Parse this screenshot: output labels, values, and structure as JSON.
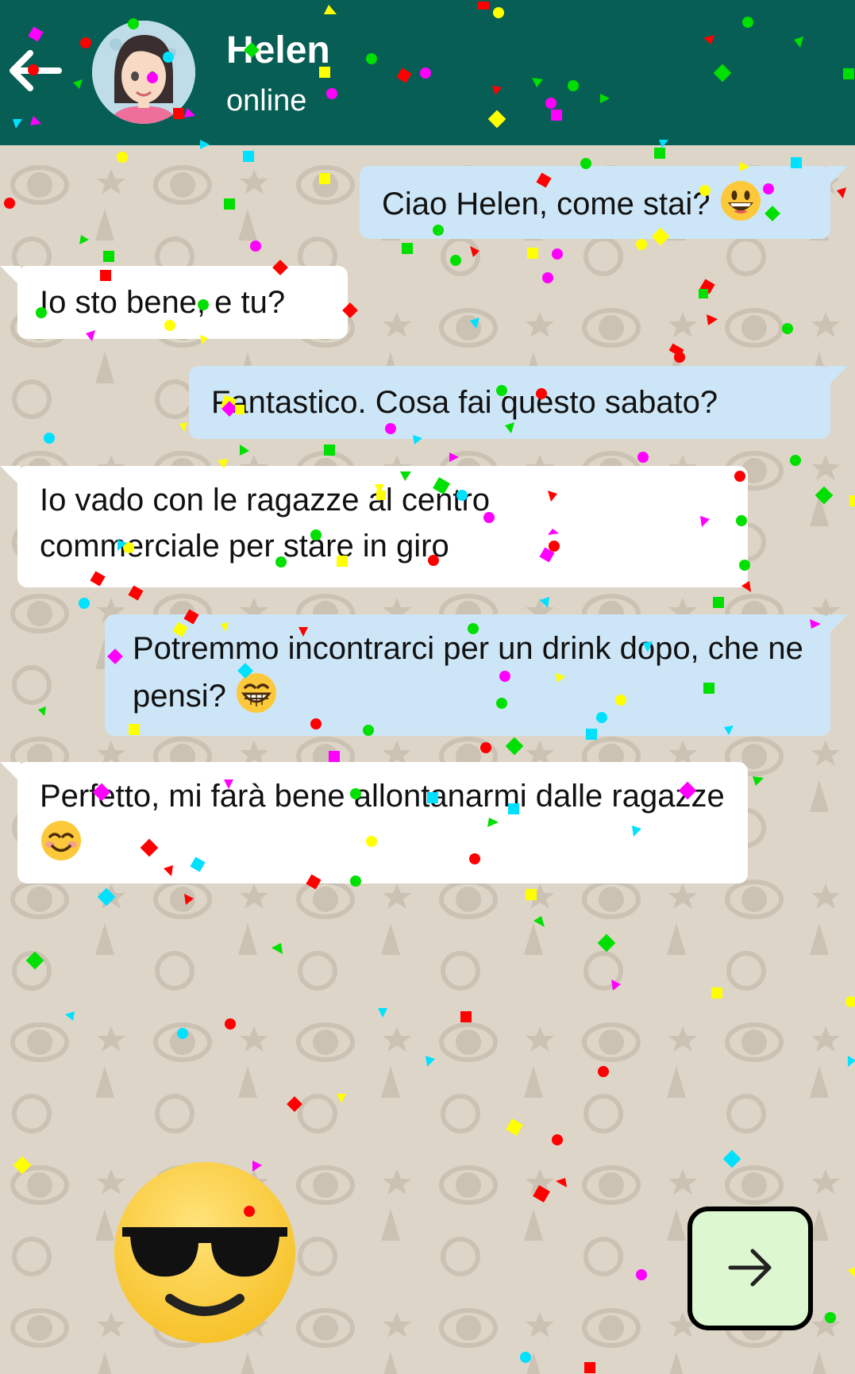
{
  "header": {
    "contact_name": "Helen",
    "contact_status": "online",
    "background_color": "#075e54",
    "back_icon": "arrow-left-icon"
  },
  "messages": [
    {
      "direction": "outgoing",
      "text": "Ciao Helen, come stai?",
      "emoji": "grinning-face-big-eyes"
    },
    {
      "direction": "incoming",
      "text": "Io sto bene, e tu?"
    },
    {
      "direction": "outgoing",
      "text": "Fantastico. Cosa fai questo sabato?"
    },
    {
      "direction": "incoming",
      "text": "Io vado con le ragazze al centro commerciale per stare in giro"
    },
    {
      "direction": "outgoing",
      "text": "Potremmo incontrarci per un drink dopo, che ne pensi?",
      "emoji": "beaming-face"
    },
    {
      "direction": "incoming",
      "text": "Perfetto, mi farà bene allontanarmi dalle ragazze",
      "emoji": "smiling-face-blush"
    }
  ],
  "colors": {
    "outgoing_bubble": "#cde6f7",
    "incoming_bubble": "#ffffff",
    "next_button": "#ddf7d0"
  },
  "controls": {
    "sticker": "sunglasses-emoji",
    "next_icon": "arrow-right-icon"
  }
}
